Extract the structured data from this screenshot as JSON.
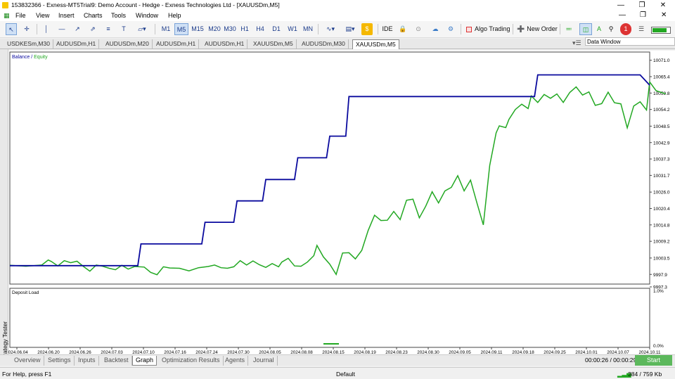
{
  "window": {
    "title": "153832366 - Exness-MT5Trial9: Demo Account - Hedge - Exness Technologies Ltd - [XAUUSDm,M5]"
  },
  "menu": [
    "File",
    "View",
    "Insert",
    "Charts",
    "Tools",
    "Window",
    "Help"
  ],
  "toolbar": {
    "timeframes": [
      "M1",
      "M5",
      "M15",
      "M20",
      "M30",
      "H1",
      "H4",
      "D1",
      "W1",
      "MN"
    ],
    "active_timeframe": "M5",
    "ide_label": "IDE",
    "algo_trading_label": "Algo Trading",
    "new_order_label": "New Order",
    "notification_count": "1"
  },
  "chart_tabs": [
    {
      "label": "USDKESm,M30",
      "active": false
    },
    {
      "label": "AUDUSDm,H1",
      "active": false
    },
    {
      "label": "AUDUSDm,M20",
      "active": false
    },
    {
      "label": "AUDUSDm,H1",
      "active": false
    },
    {
      "label": "AUDUSDm,H1",
      "active": false
    },
    {
      "label": "XAUUSDm,M5",
      "active": false
    },
    {
      "label": "AUDUSDm,M30",
      "active": false
    },
    {
      "label": "XAUUSDm,M5",
      "active": true
    }
  ],
  "data_window_title": "Data Window",
  "strategy_tester_label": "Strategy Tester",
  "chart_data": {
    "type": "line",
    "legend": {
      "balance": "Balance",
      "separator": " / ",
      "equity": "Equity"
    },
    "balance_color": "#0a0a9e",
    "equity_color": "#22a822",
    "y_ticks": [
      "10071.0",
      "10065.4",
      "10059.8",
      "10054.2",
      "10048.5",
      "10042.9",
      "10037.3",
      "10031.7",
      "10026.0",
      "10020.4",
      "10014.8",
      "10009.2",
      "10003.5",
      "9997.9",
      "9997.3"
    ],
    "ylim": [
      9994.6,
      10073.8
    ],
    "x_ticks": [
      "2024.06.04",
      "2024.06.20",
      "2024.06.26",
      "2024.07.03",
      "2024.07.10",
      "2024.07.16",
      "2024.07.24",
      "2024.07.30",
      "2024.08.05",
      "2024.08.08",
      "2024.08.15",
      "2024.08.19",
      "2024.08.23",
      "2024.08.30",
      "2024.09.05",
      "2024.09.11",
      "2024.09.18",
      "2024.09.25",
      "2024.10.01",
      "2024.10.07",
      "2024.10.11"
    ],
    "x_index_range": [
      0,
      200
    ],
    "balance": [
      [
        0,
        10000.9
      ],
      [
        40,
        10000.9
      ],
      [
        41,
        10008.3
      ],
      [
        60,
        10008.3
      ],
      [
        61,
        10015.7
      ],
      [
        70,
        10015.7
      ],
      [
        71,
        10023.0
      ],
      [
        79,
        10023.0
      ],
      [
        80,
        10030.3
      ],
      [
        89,
        10030.3
      ],
      [
        90,
        10037.7
      ],
      [
        99,
        10037.7
      ],
      [
        100,
        10045.1
      ],
      [
        105,
        10045.1
      ],
      [
        106,
        10058.6
      ],
      [
        164,
        10058.6
      ],
      [
        165,
        10066.0
      ],
      [
        197,
        10066.0
      ],
      [
        200,
        10062.5
      ]
    ],
    "equity": [
      [
        0,
        10001.0
      ],
      [
        5,
        10000.7
      ],
      [
        10,
        10001.1
      ],
      [
        12,
        10002.8
      ],
      [
        13,
        10002.3
      ],
      [
        15,
        10000.8
      ],
      [
        17,
        10002.6
      ],
      [
        19,
        10001.9
      ],
      [
        21,
        10002.4
      ],
      [
        23,
        10000.6
      ],
      [
        25,
        9999.0
      ],
      [
        27,
        10001.1
      ],
      [
        29,
        10000.7
      ],
      [
        31,
        10000.0
      ],
      [
        33,
        9999.5
      ],
      [
        35,
        10001.0
      ],
      [
        37,
        9999.7
      ],
      [
        39,
        10000.6
      ],
      [
        42,
        10000.4
      ],
      [
        44,
        9998.6
      ],
      [
        46,
        9997.8
      ],
      [
        48,
        10000.5
      ],
      [
        50,
        10000.1
      ],
      [
        53,
        10000.0
      ],
      [
        56,
        9999.1
      ],
      [
        59,
        10000.2
      ],
      [
        62,
        10000.6
      ],
      [
        64,
        10001.1
      ],
      [
        66,
        10000.2
      ],
      [
        68,
        10000.0
      ],
      [
        70,
        10000.5
      ],
      [
        72,
        10002.6
      ],
      [
        74,
        10001.1
      ],
      [
        76,
        10002.5
      ],
      [
        78,
        10001.2
      ],
      [
        80,
        10000.3
      ],
      [
        82,
        10001.6
      ],
      [
        84,
        10000.5
      ],
      [
        85,
        10002.1
      ],
      [
        87,
        10003.4
      ],
      [
        89,
        10000.8
      ],
      [
        91,
        10000.7
      ],
      [
        93,
        10002.1
      ],
      [
        95,
        10004.3
      ],
      [
        96,
        10007.8
      ],
      [
        98,
        10003.9
      ],
      [
        100,
        10001.4
      ],
      [
        102,
        9997.9
      ],
      [
        104,
        10005.2
      ],
      [
        106,
        10005.3
      ],
      [
        108,
        10003.2
      ],
      [
        110,
        10006.1
      ],
      [
        112,
        10012.9
      ],
      [
        114,
        10018.1
      ],
      [
        116,
        10016.3
      ],
      [
        118,
        10016.4
      ],
      [
        120,
        10019.4
      ],
      [
        122,
        10016.6
      ],
      [
        124,
        10023.2
      ],
      [
        126,
        10023.6
      ],
      [
        128,
        10017.2
      ],
      [
        130,
        10021.2
      ],
      [
        132,
        10026.1
      ],
      [
        134,
        10022.3
      ],
      [
        136,
        10026.4
      ],
      [
        138,
        10027.6
      ],
      [
        140,
        10031.6
      ],
      [
        142,
        10026.4
      ],
      [
        144,
        10030.1
      ],
      [
        146,
        10022.3
      ],
      [
        148,
        10014.8
      ],
      [
        150,
        10035.1
      ],
      [
        152,
        10046.2
      ],
      [
        153,
        10048.6
      ],
      [
        155,
        10048.0
      ],
      [
        156,
        10050.8
      ],
      [
        158,
        10054.2
      ],
      [
        160,
        10056.0
      ],
      [
        162,
        10054.5
      ],
      [
        163,
        10058.8
      ],
      [
        165,
        10056.6
      ],
      [
        167,
        10059.3
      ],
      [
        169,
        10058.0
      ],
      [
        171,
        10059.5
      ],
      [
        173,
        10056.6
      ],
      [
        175,
        10060.0
      ],
      [
        177,
        10061.9
      ],
      [
        179,
        10059.1
      ],
      [
        181,
        10060.2
      ],
      [
        183,
        10055.6
      ],
      [
        185,
        10056.2
      ],
      [
        187,
        10060.1
      ],
      [
        189,
        10056.5
      ],
      [
        191,
        10056.1
      ],
      [
        193,
        10047.9
      ],
      [
        195,
        10055.4
      ],
      [
        197,
        10056.8
      ],
      [
        199,
        10054.0
      ],
      [
        200,
        10063.6
      ],
      [
        202,
        10060.6
      ],
      [
        205,
        10059.5
      ]
    ],
    "deposit_load": {
      "label": "Deposit Load",
      "y_ticks": [
        "1.0%",
        "0.0%"
      ]
    }
  },
  "bottom_tabs": [
    {
      "label": "Overview",
      "active": false
    },
    {
      "label": "Settings",
      "active": false
    },
    {
      "label": "Inputs",
      "active": false
    },
    {
      "label": "Backtest",
      "active": false
    },
    {
      "label": "Graph",
      "active": true
    },
    {
      "label": "Optimization Results",
      "active": false
    },
    {
      "label": "Agents",
      "active": false
    },
    {
      "label": "Journal",
      "active": false
    }
  ],
  "timer": "00:00:26 / 00:00:29",
  "start_label": "Start",
  "status": {
    "help": "For Help, press F1",
    "profile": "Default",
    "traffic": "384 / 759 Kb"
  }
}
